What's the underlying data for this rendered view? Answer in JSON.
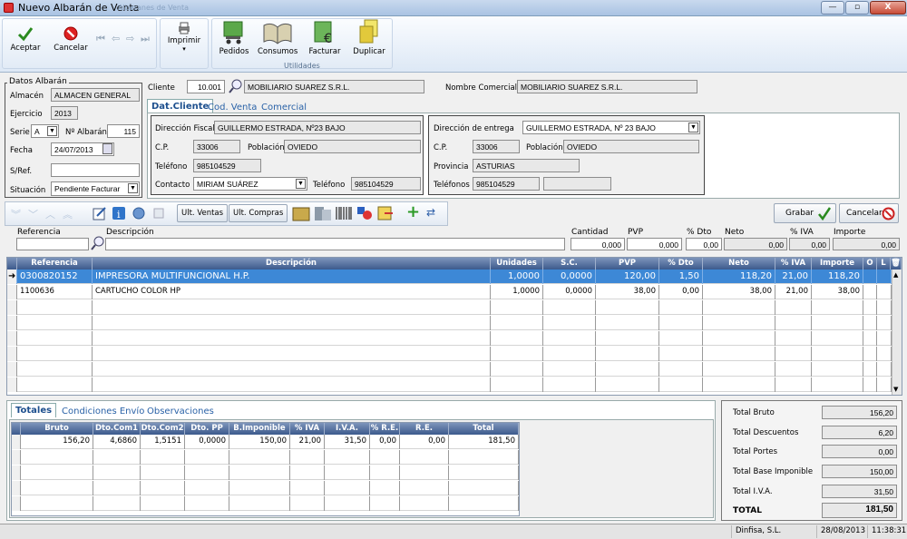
{
  "window": {
    "title": "Nuevo Albarán de Venta",
    "ghost_title": "Albaranes de Venta",
    "min": "—",
    "max": "▫",
    "close": "X"
  },
  "toolbar": {
    "aceptar": "Aceptar",
    "cancelar": "Cancelar",
    "imprimir": "Imprimir",
    "pedidos": "Pedidos",
    "consumos": "Consumos",
    "facturar": "Facturar",
    "duplicar": "Duplicar",
    "utilidades": "Utilidades"
  },
  "datos": {
    "group_title": "Datos Albarán",
    "almacen_label": "Almacén",
    "almacen": "ALMACEN GENERAL",
    "ejercicio_label": "Ejercicio",
    "ejercicio": "2013",
    "serie_label": "Serie",
    "serie": "A",
    "albaran_label": "Nº Albarán",
    "albaran": "115",
    "fecha_label": "Fecha",
    "fecha": "24/07/2013",
    "sref_label": "S/Ref.",
    "sref": "",
    "situacion_label": "Situación",
    "situacion": "Pendiente Facturar"
  },
  "cliente": {
    "label": "Cliente",
    "codigo": "10.001",
    "nombre": "MOBILIARIO SUAREZ S.R.L.",
    "nombre_comercial_label": "Nombre Comercial",
    "nombre_comercial": "MOBILIARIO SUAREZ S.R.L."
  },
  "tabs": [
    "Dat.Cliente",
    "Cod. Venta",
    "Comercial"
  ],
  "fiscal": {
    "direccion_label": "Dirección Fiscal",
    "direccion": "GUILLERMO ESTRADA, Nº23 BAJO",
    "cp_label": "C.P.",
    "cp": "33006",
    "poblacion_label": "Población",
    "poblacion": "OVIEDO",
    "telefono_label": "Teléfono",
    "telefono": "985104529",
    "contacto_label": "Contacto",
    "contacto": "MIRIAM SUÁREZ",
    "telefono2_label": "Teléfono",
    "telefono2": "985104529"
  },
  "entrega": {
    "direccion_label": "Dirección de entrega",
    "direccion": "GUILLERMO ESTRADA, Nº 23 BAJO",
    "cp_label": "C.P.",
    "cp": "33006",
    "poblacion_label": "Población",
    "poblacion": "OVIEDO",
    "provincia_label": "Provincia",
    "provincia": "ASTURIAS",
    "telefonos_label": "Teléfonos",
    "telefono": "985104529",
    "telefono2": ""
  },
  "actions": {
    "ult_ventas": "Ult. Ventas",
    "ult_compras": "Ult. Compras",
    "grabar": "Grabar",
    "cancelar": "Cancelar"
  },
  "entry": {
    "referencia_label": "Referencia",
    "descripcion_label": "Descripción",
    "cantidad_label": "Cantidad",
    "cantidad": "0,000",
    "pvp_label": "PVP",
    "pvp": "0,000",
    "dto_label": "% Dto",
    "dto": "0,00",
    "neto_label": "Neto",
    "neto": "0,00",
    "iva_label": "% IVA",
    "iva": "0,00",
    "importe_label": "Importe",
    "importe": "0,00"
  },
  "lines": {
    "headers": [
      "Referencia",
      "Descripción",
      "Unidades",
      "S.C.",
      "PVP",
      "% Dto",
      "Neto",
      "% IVA",
      "Importe",
      "O",
      "L"
    ],
    "rows": [
      [
        "0300820152",
        "IMPRESORA MULTIFUNCIONAL H.P.",
        "1,0000",
        "0,0000",
        "120,00",
        "1,50",
        "118,20",
        "21,00",
        "118,20",
        "",
        ""
      ],
      [
        "1100636",
        "CARTUCHO COLOR HP",
        "1,0000",
        "0,0000",
        "38,00",
        "0,00",
        "38,00",
        "21,00",
        "38,00",
        "",
        ""
      ]
    ]
  },
  "bottom_tabs": [
    "Totales",
    "Condiciones Envío",
    "Observaciones"
  ],
  "totals_grid": {
    "headers": [
      "Bruto",
      "Dto.Com1",
      "Dto.Com2",
      "Dto. PP",
      "B.Imponible",
      "% IVA",
      "I.V.A.",
      "% R.E.",
      "R.E.",
      "Total"
    ],
    "rows": [
      [
        "156,20",
        "4,6860",
        "1,5151",
        "0,0000",
        "150,00",
        "21,00",
        "31,50",
        "0,00",
        "0,00",
        "181,50"
      ]
    ]
  },
  "summary": {
    "bruto_label": "Total Bruto",
    "bruto": "156,20",
    "descuentos_label": "Total Descuentos",
    "descuentos": "6,20",
    "portes_label": "Total Portes",
    "portes": "0,00",
    "base_label": "Total Base Imponible",
    "base": "150,00",
    "iva_label": "Total I.V.A.",
    "iva": "31,50",
    "total_label": "TOTAL",
    "total": "181,50"
  },
  "status": {
    "company": "Dinfisa, S.L.",
    "date": "28/08/2013",
    "time": "11:38:31"
  },
  "colors": {
    "accent": "#3d88d6",
    "header": "#3c5a8c"
  }
}
